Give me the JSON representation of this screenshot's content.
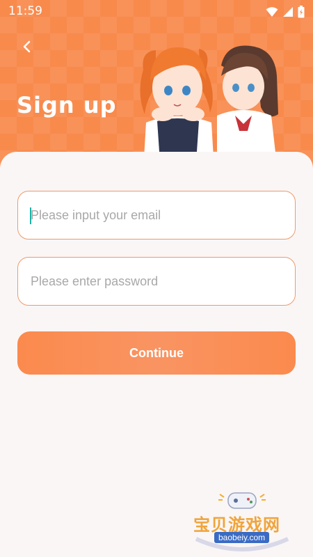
{
  "status_bar": {
    "time": "11:59",
    "icons": [
      "wifi-icon",
      "signal-icon",
      "battery-icon"
    ]
  },
  "header": {
    "title": "Sign up",
    "back_icon": "chevron-left-icon",
    "background_color": "#f88a4c"
  },
  "form": {
    "email": {
      "placeholder": "Please input your email",
      "value": ""
    },
    "password": {
      "placeholder": "Please enter password",
      "value": ""
    },
    "continue_label": "Continue",
    "accent_color": "#fb8a4d",
    "field_border_color": "#ee9a6a"
  },
  "watermark": {
    "site_name_cn": "宝贝游戏网",
    "site_url": "baobeiy.com"
  }
}
